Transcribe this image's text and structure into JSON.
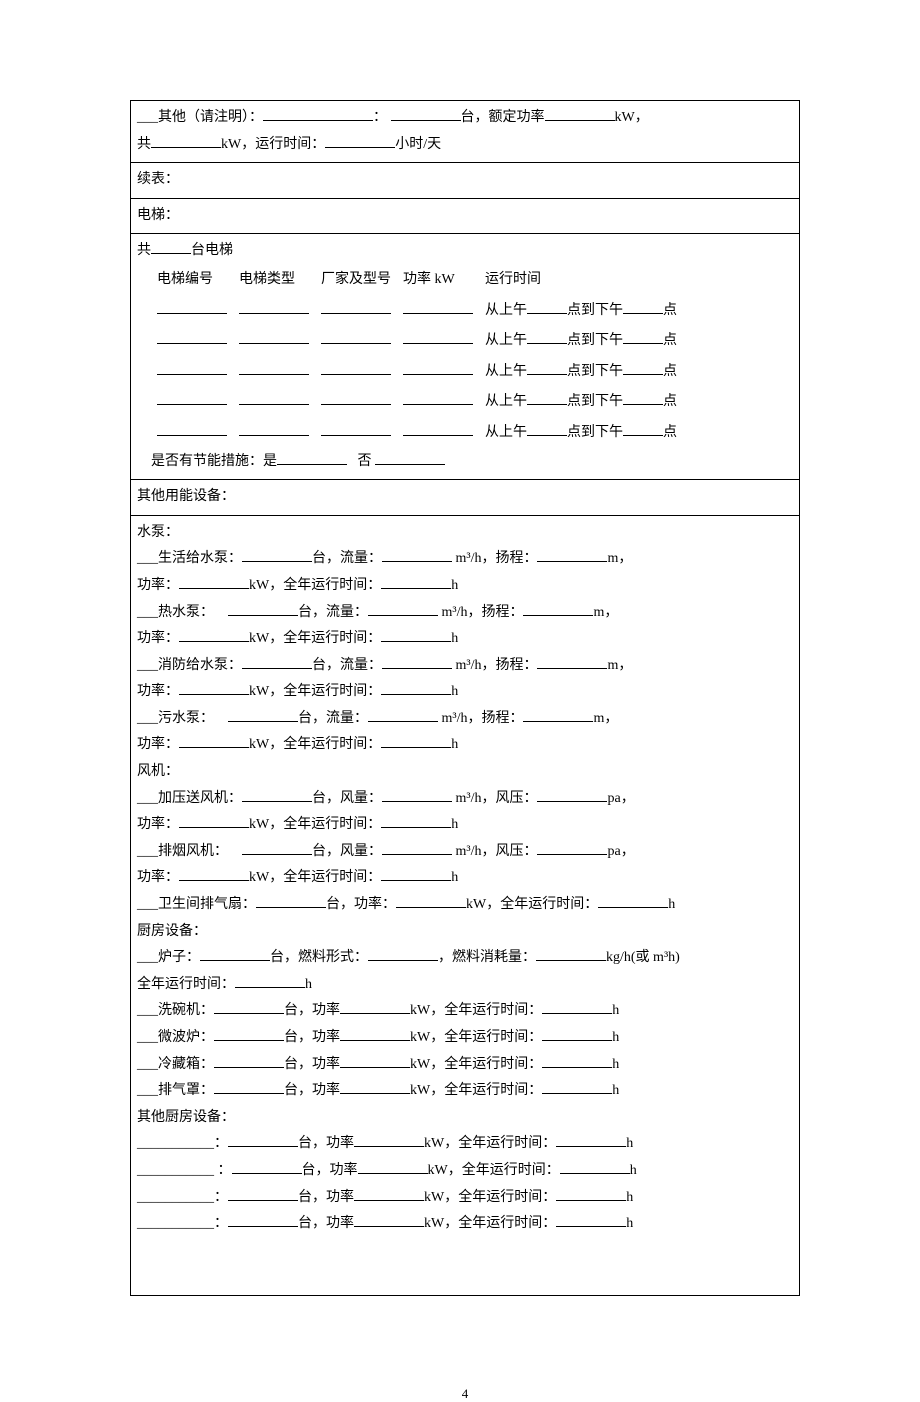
{
  "top": {
    "other_label": "___其他（请注明）：",
    "unit_tai": "台，额定功率",
    "kw": "kW，",
    "total_prefix": "共",
    "kw2": "kW，运行时间：",
    "hours_day": "小时/天"
  },
  "contd": "续表：",
  "elevator": {
    "title": "电梯：",
    "total_prefix": "共",
    "total_suffix": "台电梯",
    "hdr_no": "电梯编号",
    "hdr_type": "电梯类型",
    "hdr_mfr": "厂家及型号",
    "hdr_pwr": "功率  kW",
    "hdr_time": "运行时间",
    "from": "从上午",
    "mid": "点到下午",
    "end": "点",
    "saving_q": "是否有节能措施：是",
    "saving_no": "否"
  },
  "other_eq": "其他用能设备：",
  "pumps": {
    "title": "水泵：",
    "life": "___生活给水泵：",
    "hot": "___热水泵：",
    "fire": "___消防给水泵：",
    "sewage": "___污水泵：",
    "tai": "台，流量：",
    "flow_unit": " m³/h，扬程：",
    "head_unit": "m，",
    "power": "功率：",
    "kw_run": "kW，全年运行时间：",
    "h": "h"
  },
  "fans": {
    "title": "风机：",
    "press": "___加压送风机：",
    "smoke": "___排烟风机：",
    "tai": "台，风量：",
    "flow_unit": " m³/h，风压：",
    "pa": "pa，",
    "power": "功率：",
    "kw_run": "kW，全年运行时间：",
    "h": "h",
    "bath": "___卫生间排气扇：",
    "bath_tai": "台，功率：",
    "bath_kw": "kW，全年运行时间：",
    "bath_h": "h"
  },
  "kitchen": {
    "title": "厨房设备：",
    "stove": "___炉子：",
    "stove_tai": "台，燃料形式：",
    "stove_fuel": "，燃料消耗量：",
    "stove_unit": "kg/h(或 m³h)",
    "annual": "全年运行时间：",
    "h": "h",
    "dish": "___洗碗机：",
    "micro": "___微波炉：",
    "fridge": "___冷藏箱：",
    "hood": "___排气罩：",
    "generic_tai": "台，功率",
    "generic_kw": "kW，全年运行时间：",
    "other_title": "其他厨房设备：",
    "blank": "________：",
    "blank2": "________ ："
  },
  "pagenum": "4"
}
